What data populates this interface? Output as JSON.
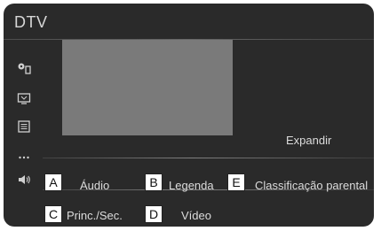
{
  "header": {
    "title": "DTV"
  },
  "sidebar": {
    "icons": [
      "settings-icon",
      "tv-icon",
      "list-icon",
      "more-icon"
    ]
  },
  "main": {
    "expand_label": "Expandir",
    "volume_icon": "volume-icon",
    "options": {
      "audio": "Áudio",
      "legend": "Legenda",
      "rating": "Classificação parental",
      "princ": "Princ./Sec.",
      "video": "Vídeo"
    }
  },
  "callouts": {
    "a": "A",
    "b": "B",
    "c": "C",
    "d": "D",
    "e": "E"
  }
}
